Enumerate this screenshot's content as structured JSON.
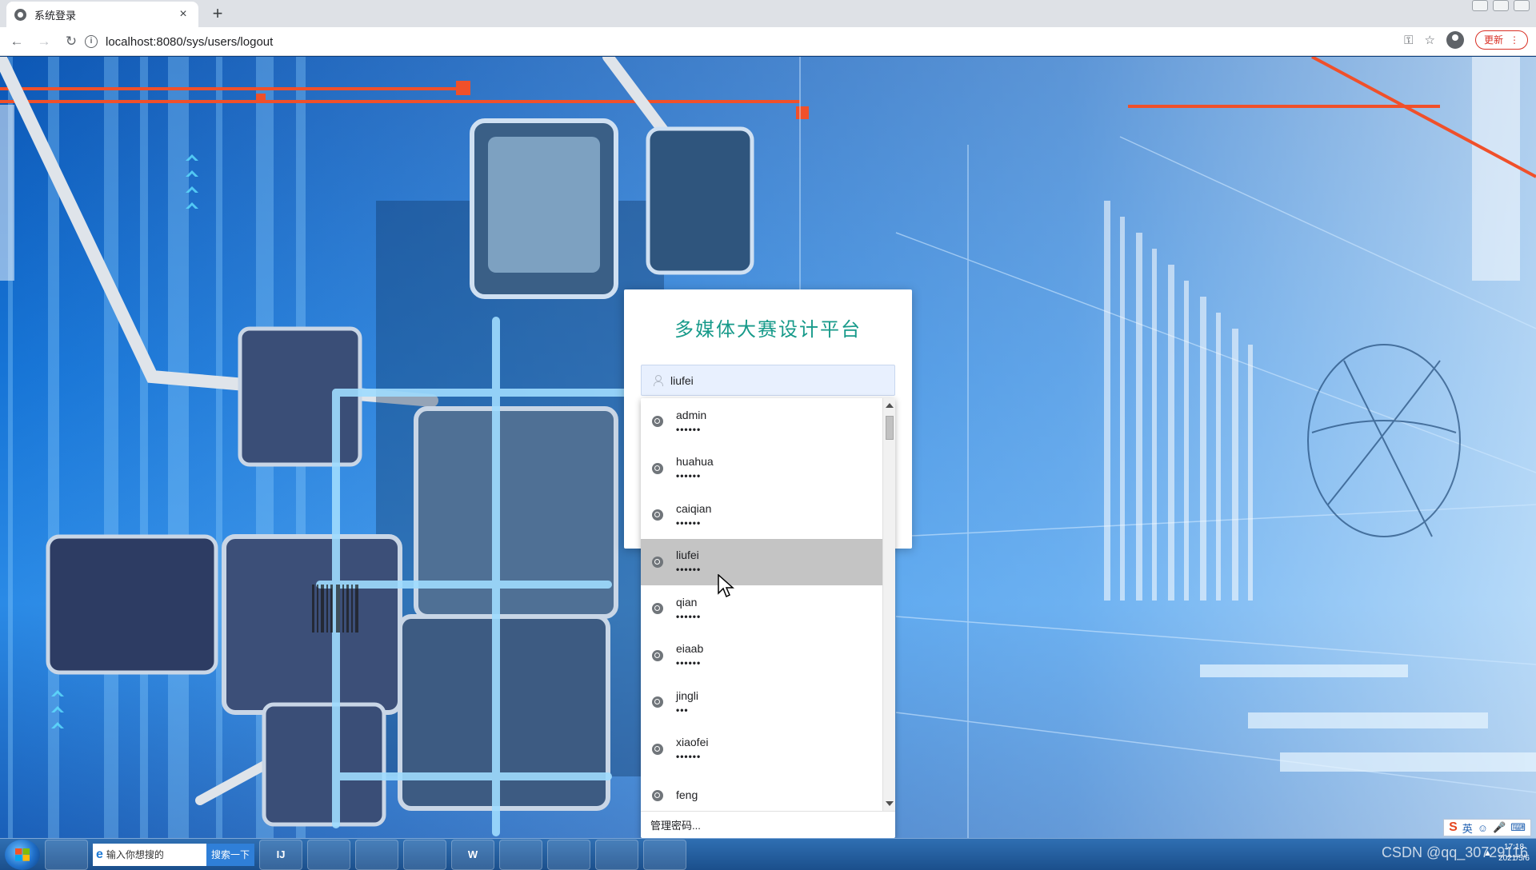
{
  "browser": {
    "tab_title": "系统登录",
    "tab_close": "×",
    "new_tab": "+",
    "back": "←",
    "forward": "→",
    "reload": "↻",
    "info": "i",
    "url": "localhost:8080/sys/users/logout",
    "key_icon": "⚿",
    "star_icon": "☆",
    "update_label": "更新",
    "menu_icon": "⋮"
  },
  "login": {
    "title": "多媒体大赛设计平台",
    "username_value": "liufei"
  },
  "autofill": {
    "items": [
      {
        "user": "admin",
        "pass": "••••••"
      },
      {
        "user": "huahua",
        "pass": "••••••"
      },
      {
        "user": "caiqian",
        "pass": "••••••"
      },
      {
        "user": "liufei",
        "pass": "••••••"
      },
      {
        "user": "qian",
        "pass": "••••••"
      },
      {
        "user": "eiaab",
        "pass": "••••••"
      },
      {
        "user": "jingli",
        "pass": "•••"
      },
      {
        "user": "xiaofei",
        "pass": "••••••"
      },
      {
        "user": "feng",
        "pass": ""
      }
    ],
    "hovered_index": 3,
    "footer": "管理密码..."
  },
  "taskbar": {
    "search_placeholder": "输入你想搜的",
    "search_button": "搜索一下",
    "search_e": "e",
    "apps": [
      "IJ",
      "",
      "",
      "",
      "W",
      "",
      "",
      "",
      ""
    ],
    "ime_s": "S",
    "ime_label": "英",
    "time": "17:18",
    "date": "2021/5/6"
  },
  "watermark": "CSDN @qq_30729116"
}
